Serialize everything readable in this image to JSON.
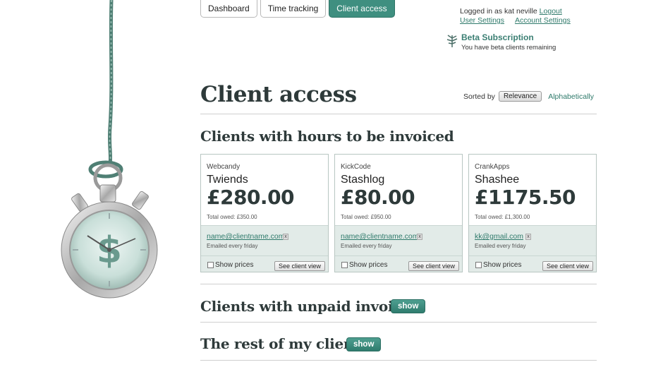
{
  "nav": {
    "tabs": [
      {
        "label": "Dashboard",
        "active": false
      },
      {
        "label": "Time tracking",
        "active": false
      },
      {
        "label": "Client access",
        "active": true
      }
    ]
  },
  "account": {
    "logged_in_text": "Logged in as kat neville",
    "logout_label": "Logout",
    "user_settings_label": "User Settings",
    "account_settings_label": "Account Settings"
  },
  "beta": {
    "title": "Beta Subscription",
    "text": "You have beta clients remaining"
  },
  "page": {
    "title": "Client access",
    "sort_label": "Sorted by",
    "sort_relevance": "Relevance",
    "sort_alpha": "Alphabetically"
  },
  "sections": {
    "hours_to_invoice": "Clients with hours to be invoiced",
    "unpaid": "Clients with unpaid invoices",
    "rest": "The rest of my clients",
    "show_label": "show"
  },
  "clients": [
    {
      "company": "Webcandy",
      "project": "Twiends",
      "amount": "£280.00",
      "total_owed": "Total owed: £350.00",
      "email": "name@clientname.com",
      "remove_label": "x",
      "frequency": "Emailed every friday",
      "show_prices_label": "Show prices",
      "view_label": "See client view"
    },
    {
      "company": "KickCode",
      "project": "Stashlog",
      "amount": "£80.00",
      "total_owed": "Total owed: £950.00",
      "email": "name@clientname.com",
      "remove_label": "x",
      "frequency": "Emailed every friday",
      "show_prices_label": "Show prices",
      "view_label": "See client view"
    },
    {
      "company": "CrankApps",
      "project": "Shashee",
      "amount": "£1175.50",
      "total_owed": "Total owed: £1,300.00",
      "email": "kk@gmail.com",
      "remove_label": "x",
      "frequency": "Emailed every friday",
      "show_prices_label": "Show prices",
      "view_label": "See client view"
    }
  ],
  "colors": {
    "accent": "#3f8f80",
    "link": "#2f7a6b",
    "panel": "#e2ebe8"
  },
  "icons": {
    "illustration": "stopwatch-dollar-icon",
    "beta": "sprig-icon"
  }
}
